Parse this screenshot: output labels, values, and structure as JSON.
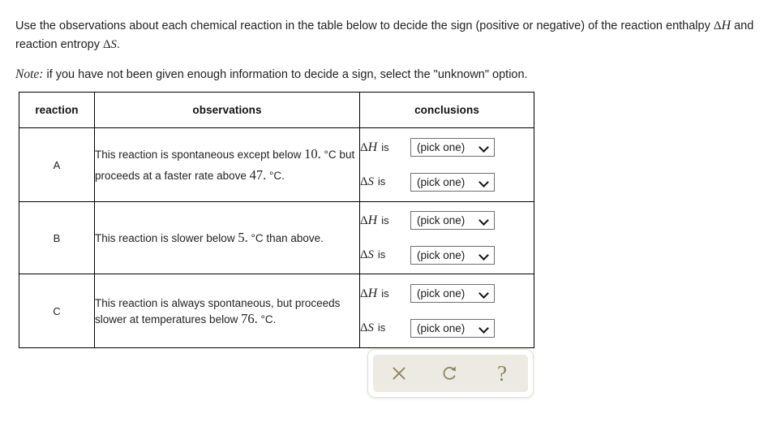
{
  "intro": {
    "line_before_dh": "Use the observations about each chemical reaction in the table below to decide the sign (positive or negative) of the reaction enthalpy ",
    "dh_symbol": "H",
    "between_symbols": " and reaction entropy ",
    "ds_symbol": "S",
    "line_end": ".",
    "delta": "Δ"
  },
  "note": {
    "label": "Note:",
    "text": " if you have not been given enough information to decide a sign, select the \"unknown\" option."
  },
  "table": {
    "headers": {
      "reaction": "reaction",
      "observations": "observations",
      "conclusions": "conclusions"
    },
    "rows": [
      {
        "reaction": "A",
        "observation_parts": [
          {
            "type": "text",
            "value": "This reaction is spontaneous except below "
          },
          {
            "type": "num",
            "value": "10."
          },
          {
            "type": "text",
            "value": " °C but proceeds at a faster rate above "
          },
          {
            "type": "num",
            "value": "47."
          },
          {
            "type": "text",
            "value": " °C."
          }
        ],
        "observation_plain": "This reaction is spontaneous except below 10. °C but proceeds at a faster rate above 47. °C.",
        "conclusions": [
          {
            "symbol": "H",
            "verb": "is",
            "value": "(pick one)"
          },
          {
            "symbol": "S",
            "verb": "is",
            "value": "(pick one)"
          }
        ]
      },
      {
        "reaction": "B",
        "observation_parts": [
          {
            "type": "text",
            "value": "This reaction is slower below "
          },
          {
            "type": "num",
            "value": "5."
          },
          {
            "type": "text",
            "value": " °C than above."
          }
        ],
        "observation_plain": "This reaction is slower below 5. °C than above.",
        "conclusions": [
          {
            "symbol": "H",
            "verb": "is",
            "value": "(pick one)"
          },
          {
            "symbol": "S",
            "verb": "is",
            "value": "(pick one)"
          }
        ]
      },
      {
        "reaction": "C",
        "observation_parts": [
          {
            "type": "text",
            "value": "This reaction is always spontaneous, but proceeds slower at temperatures below "
          },
          {
            "type": "num",
            "value": "76."
          },
          {
            "type": "text",
            "value": " °C."
          }
        ],
        "observation_plain": "This reaction is always spontaneous, but proceeds slower at temperatures below 76. °C.",
        "conclusions": [
          {
            "symbol": "H",
            "verb": "is",
            "value": "(pick one)"
          },
          {
            "symbol": "S",
            "verb": "is",
            "value": "(pick one)"
          }
        ]
      }
    ]
  },
  "toolbar": {
    "buttons": [
      {
        "name": "clear",
        "icon": "close-icon",
        "glyph": "×"
      },
      {
        "name": "reset",
        "icon": "undo-arrow-icon",
        "glyph": "↺"
      },
      {
        "name": "help",
        "icon": "question-mark-icon",
        "glyph": "?"
      }
    ],
    "icon_color": "#8a8159",
    "panel_color": "#eceae2"
  },
  "colors": {
    "text": "#1f1f1f",
    "border": "#000000",
    "select_border": "#6e6e6e",
    "toolbar_icon": "#8a8159",
    "toolbar_panel": "#eceae2"
  }
}
